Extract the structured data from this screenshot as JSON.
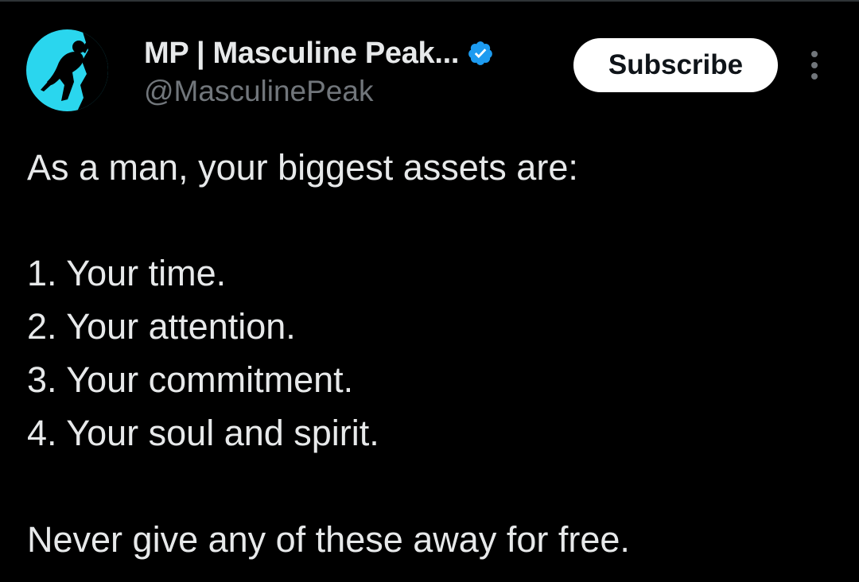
{
  "author": {
    "display_name": "MP | Masculine Peak...",
    "handle": "@MasculinePeak",
    "verified": true,
    "avatar_icon": "climber-silhouette-icon",
    "avatar_color": "#2ad6ee"
  },
  "actions": {
    "subscribe_label": "Subscribe",
    "more_icon": "more-vertical-icon"
  },
  "tweet": {
    "intro": "As a man, your biggest assets are:",
    "list": [
      "1. Your time.",
      "2. Your attention.",
      "3. Your commitment.",
      "4. Your soul and spirit."
    ],
    "closing": "Never give any of these away for free."
  },
  "colors": {
    "background": "#000000",
    "text": "#e7e9ea",
    "secondary_text": "#71767b",
    "verified_badge": "#1d9bf0",
    "button_bg": "#ffffff"
  }
}
